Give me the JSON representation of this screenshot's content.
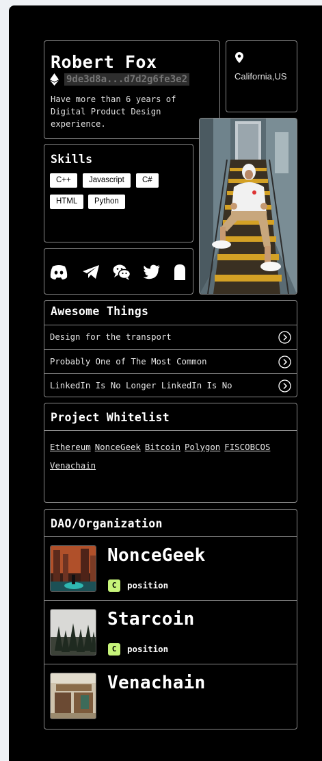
{
  "profile": {
    "name": "Robert Fox",
    "address": "9de3d8a...d7d2g6fe3e2",
    "bio": "Have more than 6 years of Digital Product Design experience."
  },
  "location": {
    "text": "California,US"
  },
  "skills": {
    "title": "Skills",
    "items": [
      "C++",
      "Javascript",
      "C#",
      "HTML",
      "Python"
    ]
  },
  "social": {
    "icons": [
      "discord-icon",
      "telegram-icon",
      "wechat-icon",
      "twitter-icon",
      "ghost-icon"
    ]
  },
  "awesome": {
    "title": "Awesome Things",
    "items": [
      "Design for the transport",
      "Probably One of The Most Common",
      "LinkedIn Is No Longer LinkedIn Is No"
    ]
  },
  "whitelist": {
    "title": "Project Whitelist",
    "items": [
      "Ethereum",
      "NonceGeek",
      "Bitcoin",
      "Polygon",
      "FISCOBCOS",
      "Venachain"
    ]
  },
  "dao": {
    "title": "DAO/Organization",
    "items": [
      {
        "name": "NonceGeek",
        "badge": "C",
        "position": "position"
      },
      {
        "name": "Starcoin",
        "badge": "C",
        "position": "position"
      },
      {
        "name": "Venachain"
      }
    ]
  },
  "colors": {
    "background": "#000000",
    "border": "#8c8c8c",
    "badge": "#c7f47a",
    "page": "#eef1f5"
  }
}
